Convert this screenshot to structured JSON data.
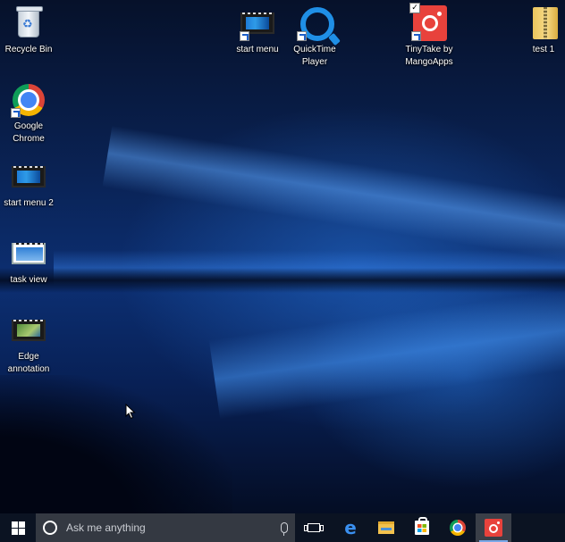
{
  "desktop": {
    "icons": [
      {
        "label": "Recycle Bin"
      },
      {
        "label": "start menu"
      },
      {
        "label": "QuickTime Player"
      },
      {
        "label": "TinyTake by MangoApps"
      },
      {
        "label": "test 1"
      },
      {
        "label": "Google Chrome"
      },
      {
        "label": "start menu 2"
      },
      {
        "label": "task view"
      },
      {
        "label": "Edge annotation"
      }
    ]
  },
  "taskbar": {
    "search_placeholder": "Ask me anything",
    "pinned": [
      {
        "icon": "task-view-icon"
      },
      {
        "icon": "edge-icon"
      },
      {
        "icon": "file-explorer-icon"
      },
      {
        "icon": "store-icon"
      },
      {
        "icon": "chrome-icon"
      },
      {
        "icon": "tinytake-icon",
        "active": true
      }
    ]
  },
  "colors": {
    "taskbar": "#0b1322",
    "search_box": "#343942",
    "accent": "#1f8fe6",
    "tinytake_red": "#e8423c"
  }
}
